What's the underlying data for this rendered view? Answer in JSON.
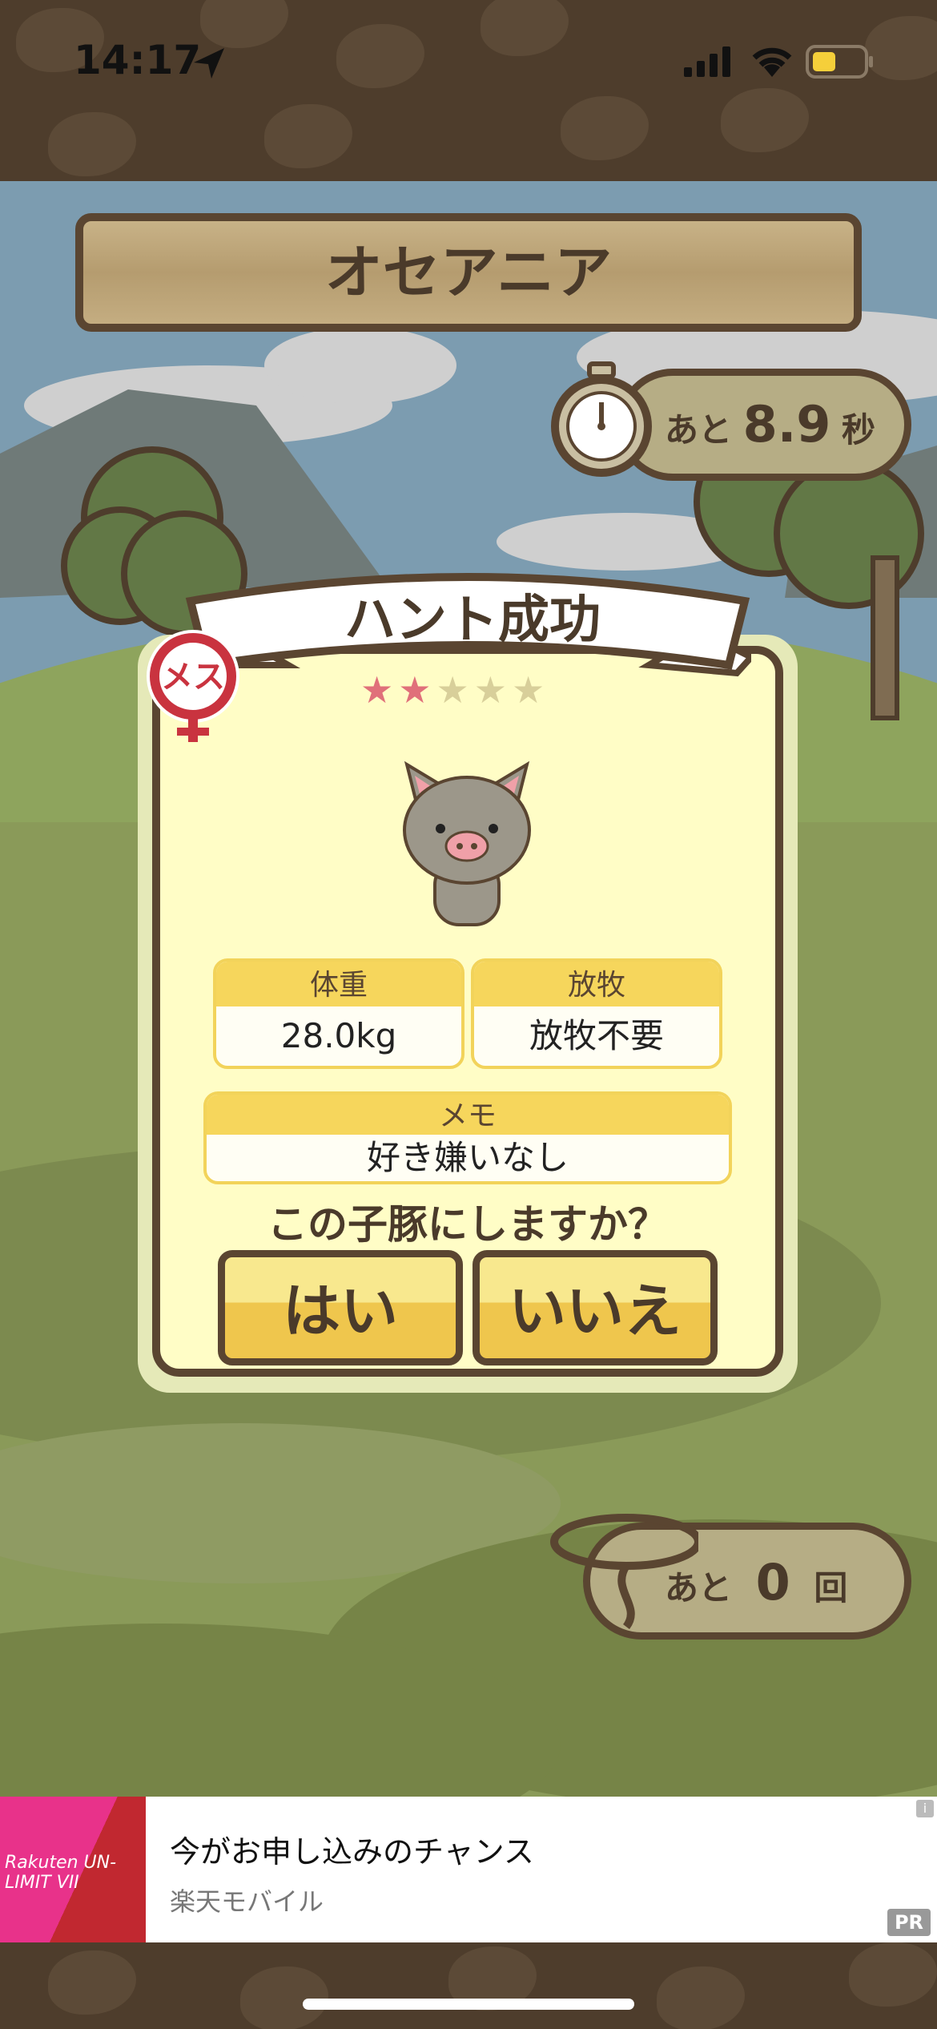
{
  "status_bar": {
    "time": "14:17"
  },
  "region": {
    "title": "オセアニア"
  },
  "timer": {
    "prefix": "あと",
    "value": "8.9",
    "unit": "秒"
  },
  "result": {
    "banner": "ハント成功",
    "stars_filled": 2,
    "stars_total": 5,
    "gender_label": "メス",
    "weight_label": "体重",
    "weight_value": "28.0kg",
    "graze_label": "放牧",
    "graze_value": "放牧不要",
    "memo_label": "メモ",
    "memo_value": "好き嫌いなし",
    "question": "この子豚にしますか？",
    "yes_label": "はい",
    "no_label": "いいえ"
  },
  "lasso": {
    "prefix": "あと",
    "value": "0",
    "unit": "回"
  },
  "ad": {
    "logo_text": "Rakuten UN-LIMIT VII",
    "title": "今がお申し込みのチャンス",
    "subtitle": "楽天モバイル",
    "pr_label": "PR",
    "info_label": "i"
  },
  "colors": {
    "star_filled": "#e0707a",
    "star_empty": "#d8cf9a",
    "accent_yellow": "#f6d65c",
    "wood_border": "#5a4531"
  }
}
